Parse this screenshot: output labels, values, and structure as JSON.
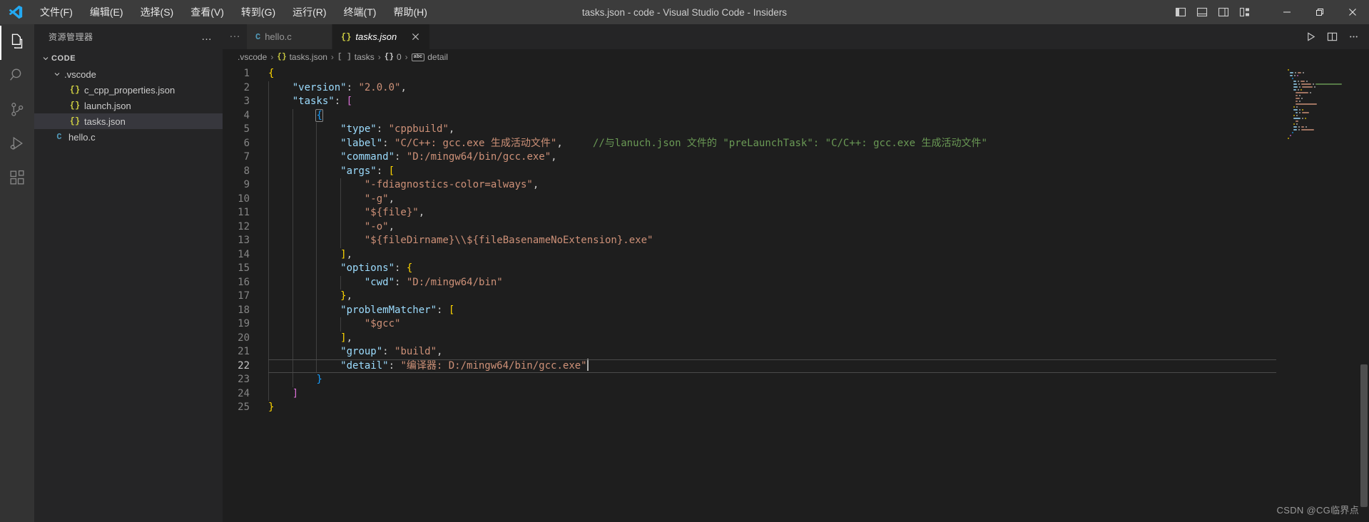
{
  "window": {
    "title": "tasks.json - code - Visual Studio Code - Insiders",
    "logo_name": "vscode-insiders-logo"
  },
  "menu": {
    "items": [
      {
        "label": "文件(F)",
        "name": "menu-file"
      },
      {
        "label": "编辑(E)",
        "name": "menu-edit"
      },
      {
        "label": "选择(S)",
        "name": "menu-selection"
      },
      {
        "label": "查看(V)",
        "name": "menu-view"
      },
      {
        "label": "转到(G)",
        "name": "menu-go"
      },
      {
        "label": "运行(R)",
        "name": "menu-run"
      },
      {
        "label": "终端(T)",
        "name": "menu-terminal"
      },
      {
        "label": "帮助(H)",
        "name": "menu-help"
      }
    ]
  },
  "titlebar_controls": {
    "layout": [
      {
        "name": "toggle-primary-sidebar-icon",
        "title": "切换主侧栏"
      },
      {
        "name": "toggle-panel-icon",
        "title": "切换面板"
      },
      {
        "name": "toggle-secondary-sidebar-icon",
        "title": "切换辅助侧栏"
      },
      {
        "name": "customize-layout-icon",
        "title": "自定义布局"
      }
    ],
    "minimize": "minimize-icon",
    "maximize": "restore-icon",
    "close": "close-icon"
  },
  "activitybar": {
    "items": [
      {
        "name": "activity-explorer",
        "icon": "files-icon",
        "active": true
      },
      {
        "name": "activity-search",
        "icon": "search-icon",
        "active": false
      },
      {
        "name": "activity-source-control",
        "icon": "source-control-icon",
        "active": false
      },
      {
        "name": "activity-run-and-debug",
        "icon": "run-debug-icon",
        "active": false
      },
      {
        "name": "activity-extensions",
        "icon": "extensions-icon",
        "active": false
      }
    ]
  },
  "sidebar": {
    "title": "资源管理器",
    "more_actions": "…",
    "root": {
      "label": "CODE",
      "expanded": true
    },
    "tree": [
      {
        "label": ".vscode",
        "type": "folder",
        "indent": 1,
        "expanded": true,
        "icon": "chevron-down-icon",
        "selected": false
      },
      {
        "label": "c_cpp_properties.json",
        "type": "json",
        "indent": 2,
        "icon": "json-file-icon",
        "selected": false
      },
      {
        "label": "launch.json",
        "type": "json",
        "indent": 2,
        "icon": "json-file-icon",
        "selected": false
      },
      {
        "label": "tasks.json",
        "type": "json",
        "indent": 2,
        "icon": "json-file-icon",
        "selected": true
      },
      {
        "label": "hello.c",
        "type": "c",
        "indent": 1,
        "icon": "c-file-icon",
        "selected": false
      }
    ]
  },
  "editor": {
    "overflow_actions": "…",
    "tabs": [
      {
        "label": "hello.c",
        "icon": "C",
        "icon_kind": "c",
        "active": false,
        "closable": false
      },
      {
        "label": "tasks.json",
        "icon": "{}",
        "icon_kind": "json",
        "active": true,
        "closable": true,
        "close_icon": "close-icon"
      }
    ],
    "actions": [
      {
        "name": "run-code-button",
        "icon": "play-icon"
      },
      {
        "name": "split-editor-right-button",
        "icon": "split-editor-icon"
      },
      {
        "name": "more-actions-button",
        "icon": "ellipsis-icon"
      }
    ],
    "breadcrumbs": [
      {
        "label": ".vscode",
        "icon": ""
      },
      {
        "label": "tasks.json",
        "icon": "{}",
        "icon_kind": "json"
      },
      {
        "label": "tasks",
        "icon": "[ ]",
        "icon_kind": "array"
      },
      {
        "label": "0",
        "icon": "{}",
        "icon_kind": "obj"
      },
      {
        "label": "detail",
        "icon": "abc",
        "icon_kind": "abc"
      }
    ],
    "separator": "›",
    "cursor_line": 22,
    "lines": [
      {
        "n": 1,
        "tokens": [
          {
            "t": "{",
            "c": "t-b1"
          }
        ]
      },
      {
        "n": 2,
        "tokens": [
          {
            "t": "    ",
            "c": "t-punct"
          },
          {
            "t": "\"version\"",
            "c": "t-key"
          },
          {
            "t": ": ",
            "c": "t-punct"
          },
          {
            "t": "\"2.0.0\"",
            "c": "t-str"
          },
          {
            "t": ",",
            "c": "t-punct"
          }
        ]
      },
      {
        "n": 3,
        "tokens": [
          {
            "t": "    ",
            "c": "t-punct"
          },
          {
            "t": "\"tasks\"",
            "c": "t-key"
          },
          {
            "t": ": ",
            "c": "t-punct"
          },
          {
            "t": "[",
            "c": "t-b2"
          }
        ]
      },
      {
        "n": 4,
        "tokens": [
          {
            "t": "        ",
            "c": "t-punct"
          },
          {
            "t": "{",
            "c": "t-b3",
            "match": true
          }
        ]
      },
      {
        "n": 5,
        "tokens": [
          {
            "t": "            ",
            "c": "t-punct"
          },
          {
            "t": "\"type\"",
            "c": "t-key"
          },
          {
            "t": ": ",
            "c": "t-punct"
          },
          {
            "t": "\"cppbuild\"",
            "c": "t-str"
          },
          {
            "t": ",",
            "c": "t-punct"
          }
        ]
      },
      {
        "n": 6,
        "tokens": [
          {
            "t": "            ",
            "c": "t-punct"
          },
          {
            "t": "\"label\"",
            "c": "t-key"
          },
          {
            "t": ": ",
            "c": "t-punct"
          },
          {
            "t": "\"C/C++: gcc.exe 生成活动文件\"",
            "c": "t-str"
          },
          {
            "t": ",",
            "c": "t-punct"
          },
          {
            "t": "     ",
            "c": "t-punct"
          },
          {
            "t": "//与lanuch.json 文件的 \"preLaunchTask\": \"C/C++: gcc.exe 生成活动文件\"",
            "c": "t-com"
          }
        ]
      },
      {
        "n": 7,
        "tokens": [
          {
            "t": "            ",
            "c": "t-punct"
          },
          {
            "t": "\"command\"",
            "c": "t-key"
          },
          {
            "t": ": ",
            "c": "t-punct"
          },
          {
            "t": "\"D:/mingw64/bin/gcc.exe\"",
            "c": "t-str"
          },
          {
            "t": ",",
            "c": "t-punct"
          }
        ]
      },
      {
        "n": 8,
        "tokens": [
          {
            "t": "            ",
            "c": "t-punct"
          },
          {
            "t": "\"args\"",
            "c": "t-key"
          },
          {
            "t": ": ",
            "c": "t-punct"
          },
          {
            "t": "[",
            "c": "t-b1"
          }
        ]
      },
      {
        "n": 9,
        "tokens": [
          {
            "t": "                ",
            "c": "t-punct"
          },
          {
            "t": "\"-fdiagnostics-color=always\"",
            "c": "t-str"
          },
          {
            "t": ",",
            "c": "t-punct"
          }
        ]
      },
      {
        "n": 10,
        "tokens": [
          {
            "t": "                ",
            "c": "t-punct"
          },
          {
            "t": "\"-g\"",
            "c": "t-str"
          },
          {
            "t": ",",
            "c": "t-punct"
          }
        ]
      },
      {
        "n": 11,
        "tokens": [
          {
            "t": "                ",
            "c": "t-punct"
          },
          {
            "t": "\"${file}\"",
            "c": "t-str"
          },
          {
            "t": ",",
            "c": "t-punct"
          }
        ]
      },
      {
        "n": 12,
        "tokens": [
          {
            "t": "                ",
            "c": "t-punct"
          },
          {
            "t": "\"-o\"",
            "c": "t-str"
          },
          {
            "t": ",",
            "c": "t-punct"
          }
        ]
      },
      {
        "n": 13,
        "tokens": [
          {
            "t": "                ",
            "c": "t-punct"
          },
          {
            "t": "\"${fileDirname}\\\\${fileBasenameNoExtension}.exe\"",
            "c": "t-str"
          }
        ]
      },
      {
        "n": 14,
        "tokens": [
          {
            "t": "            ",
            "c": "t-punct"
          },
          {
            "t": "]",
            "c": "t-b1"
          },
          {
            "t": ",",
            "c": "t-punct"
          }
        ]
      },
      {
        "n": 15,
        "tokens": [
          {
            "t": "            ",
            "c": "t-punct"
          },
          {
            "t": "\"options\"",
            "c": "t-key"
          },
          {
            "t": ": ",
            "c": "t-punct"
          },
          {
            "t": "{",
            "c": "t-b1"
          }
        ]
      },
      {
        "n": 16,
        "tokens": [
          {
            "t": "                ",
            "c": "t-punct"
          },
          {
            "t": "\"cwd\"",
            "c": "t-key"
          },
          {
            "t": ": ",
            "c": "t-punct"
          },
          {
            "t": "\"D:/mingw64/bin\"",
            "c": "t-str"
          }
        ]
      },
      {
        "n": 17,
        "tokens": [
          {
            "t": "            ",
            "c": "t-punct"
          },
          {
            "t": "}",
            "c": "t-b1"
          },
          {
            "t": ",",
            "c": "t-punct"
          }
        ]
      },
      {
        "n": 18,
        "tokens": [
          {
            "t": "            ",
            "c": "t-punct"
          },
          {
            "t": "\"problemMatcher\"",
            "c": "t-key"
          },
          {
            "t": ": ",
            "c": "t-punct"
          },
          {
            "t": "[",
            "c": "t-b1"
          }
        ]
      },
      {
        "n": 19,
        "tokens": [
          {
            "t": "                ",
            "c": "t-punct"
          },
          {
            "t": "\"$gcc\"",
            "c": "t-str"
          }
        ]
      },
      {
        "n": 20,
        "tokens": [
          {
            "t": "            ",
            "c": "t-punct"
          },
          {
            "t": "]",
            "c": "t-b1"
          },
          {
            "t": ",",
            "c": "t-punct"
          }
        ]
      },
      {
        "n": 21,
        "tokens": [
          {
            "t": "            ",
            "c": "t-punct"
          },
          {
            "t": "\"group\"",
            "c": "t-key"
          },
          {
            "t": ": ",
            "c": "t-punct"
          },
          {
            "t": "\"build\"",
            "c": "t-str"
          },
          {
            "t": ",",
            "c": "t-punct"
          }
        ]
      },
      {
        "n": 22,
        "tokens": [
          {
            "t": "            ",
            "c": "t-punct"
          },
          {
            "t": "\"detail\"",
            "c": "t-key"
          },
          {
            "t": ": ",
            "c": "t-punct"
          },
          {
            "t": "\"编译器: D:/mingw64/bin/gcc.exe\"",
            "c": "t-str"
          }
        ],
        "cursor": true,
        "current": true
      },
      {
        "n": 23,
        "tokens": [
          {
            "t": "        ",
            "c": "t-punct"
          },
          {
            "t": "}",
            "c": "t-b3"
          }
        ]
      },
      {
        "n": 24,
        "tokens": [
          {
            "t": "    ",
            "c": "t-punct"
          },
          {
            "t": "]",
            "c": "t-b2"
          }
        ]
      },
      {
        "n": 25,
        "tokens": [
          {
            "t": "}",
            "c": "t-b1"
          }
        ]
      }
    ]
  },
  "minimap": {
    "name": "editor-minimap"
  },
  "scrollbar": {
    "name": "editor-vertical-scrollbar"
  },
  "watermark": {
    "text": "CSDN @CG临界点"
  },
  "colors": {
    "titlebar_bg": "#3c3c3c",
    "activitybar_bg": "#333333",
    "sidebar_bg": "#252526",
    "editor_bg": "#1e1e1e",
    "tab_active_bg": "#1e1e1e",
    "tab_inactive_bg": "#2d2d2d",
    "selection_bg": "#37373d",
    "accent_json": "#cbcb41",
    "accent_c": "#519aba",
    "string": "#ce9178",
    "key": "#9cdcfe",
    "comment": "#6a9955",
    "bracket1": "#ffd700",
    "bracket2": "#da70d6",
    "bracket3": "#179fff"
  }
}
